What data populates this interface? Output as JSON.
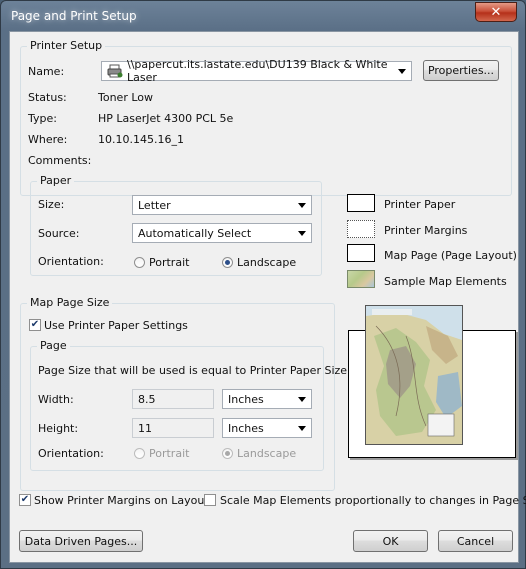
{
  "window": {
    "title": "Page and Print Setup",
    "close_glyph": "✕"
  },
  "printer_setup": {
    "group_label": "Printer Setup",
    "name_label": "Name:",
    "name_value": "\\\\papercut.its.iastate.edu\\DU139 Black & White Laser",
    "properties_label": "Properties...",
    "status_label": "Status:",
    "status_value": "Toner Low",
    "type_label": "Type:",
    "type_value": "HP LaserJet 4300 PCL 5e",
    "where_label": "Where:",
    "where_value": "10.10.145.16_1",
    "comments_label": "Comments:"
  },
  "paper": {
    "group_label": "Paper",
    "size_label": "Size:",
    "size_value": "Letter",
    "source_label": "Source:",
    "source_value": "Automatically Select",
    "orientation_label": "Orientation:",
    "portrait_label": "Portrait",
    "landscape_label": "Landscape",
    "orientation_selected": "Landscape"
  },
  "legend": {
    "printer_paper": "Printer Paper",
    "printer_margins": "Printer Margins",
    "map_page": "Map Page (Page Layout)",
    "sample_map": "Sample Map Elements"
  },
  "map_page_size": {
    "group_label": "Map Page Size",
    "use_printer_settings_label": "Use Printer Paper Settings",
    "use_printer_settings_checked": true,
    "page_group_label": "Page",
    "info_text": "Page Size that will be used is equal to Printer Paper Size",
    "width_label": "Width:",
    "width_value": "8.5",
    "width_unit": "Inches",
    "height_label": "Height:",
    "height_value": "11",
    "height_unit": "Inches",
    "orientation_label": "Orientation:",
    "portrait_label": "Portrait",
    "landscape_label": "Landscape",
    "orientation_selected": "Landscape"
  },
  "options": {
    "show_margins_label": "Show Printer Margins on Layout",
    "show_margins_checked": true,
    "scale_elements_label": "Scale Map Elements proportionally to changes in Page Size",
    "scale_elements_checked": false
  },
  "buttons": {
    "data_driven_pages": "Data Driven Pages...",
    "ok": "OK",
    "cancel": "Cancel"
  },
  "icons": {
    "printer": "network-printer-icon",
    "checkmark_glyph": "✔"
  }
}
